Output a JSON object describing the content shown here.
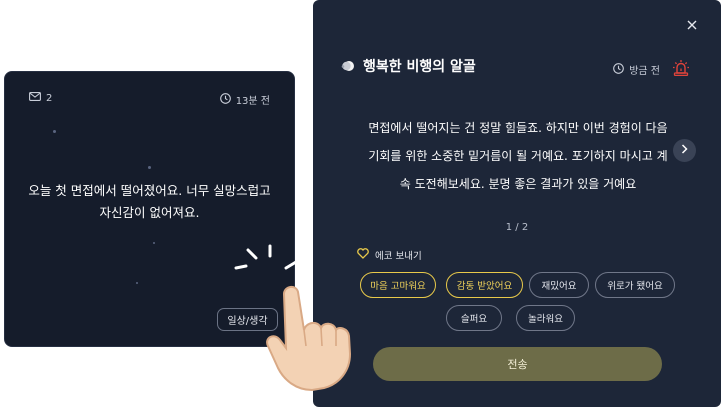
{
  "post": {
    "letter_count": "2",
    "time_ago": "13분 전",
    "text": "오늘 첫 면접에서 떨어졌어요. 너무 실망스럽고\n자신감이 없어져요.",
    "category": "일상/생각"
  },
  "reply": {
    "title": "행복한 비행의 알골",
    "time_ago": "방금 전",
    "text": "면접에서 떨어지는 건 정말 힘들죠. 하지만 이번 경험이 다음\n기회를 위한 소중한 밑거름이 될 거예요. 포기하지 마시고 계\n속 도전해보세요. 분명 좋은 결과가 있을 거예요",
    "pager": "1 / 2",
    "echo_label": "에코 보내기",
    "chips": [
      {
        "label": "마음 고마워요",
        "selected": true
      },
      {
        "label": "감동 받았어요",
        "selected": true
      },
      {
        "label": "재밌어요",
        "selected": false
      },
      {
        "label": "위로가 됐어요",
        "selected": false
      },
      {
        "label": "슬퍼요",
        "selected": false
      },
      {
        "label": "놀라워요",
        "selected": false
      }
    ],
    "send_label": "전송"
  },
  "icons": {
    "close": "close-icon",
    "next": "chevron-right-icon",
    "mail": "mail-icon",
    "clock": "clock-icon",
    "siren": "siren-icon",
    "heart": "heart-icon",
    "avatar": "moon-avatar-icon"
  },
  "colors": {
    "panel_bg": "#1d2638",
    "card_bg": "#151c2b",
    "accent_yellow": "#e8c94a",
    "siren_red": "#e0433b",
    "send_bg": "#6d6c48"
  }
}
